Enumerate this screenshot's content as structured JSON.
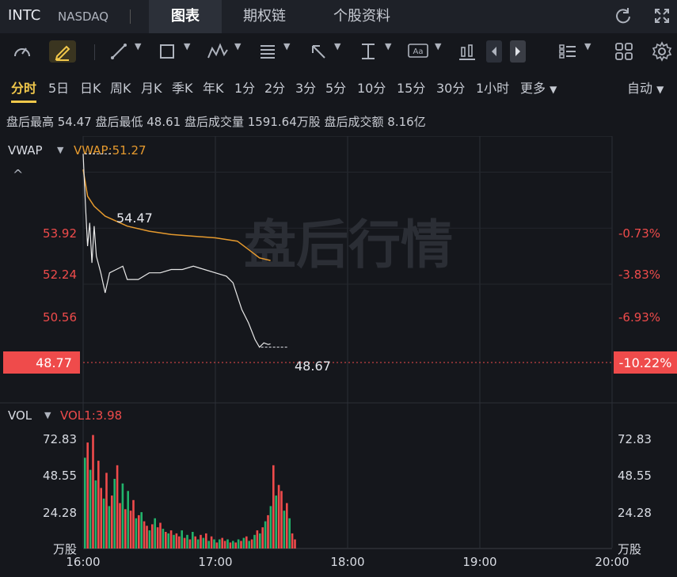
{
  "header": {
    "symbol": "INTC",
    "exchange": "NASDAQ",
    "tabs": [
      {
        "label": "图表",
        "active": true
      },
      {
        "label": "期权链",
        "active": false
      },
      {
        "label": "个股资料",
        "active": false
      }
    ]
  },
  "toolbar": {
    "tools": [
      "gauge-icon",
      "pen-icon",
      "line-icon",
      "rect-icon",
      "wave-icon",
      "fib-icon",
      "arrow-icon",
      "measure-icon",
      "text-icon",
      "candle-icon",
      "prev-icon",
      "next-icon",
      "list-icon",
      "grid-icon",
      "gear-icon"
    ],
    "text_tool_label": "Aa"
  },
  "periods": {
    "items": [
      "分时",
      "5日",
      "日K",
      "周K",
      "月K",
      "季K",
      "年K",
      "1分",
      "2分",
      "3分",
      "5分",
      "10分",
      "15分",
      "30分",
      "1小时",
      "更多"
    ],
    "active_index": 0,
    "auto_label": "自动"
  },
  "stats": {
    "text": "盘后最高 54.47  盘后最低 48.61  盘后成交量 1591.64万股  盘后成交额 8.16亿"
  },
  "price_pane": {
    "indicator": "VWAP",
    "indicator_value": "VWAP:51.27",
    "watermark": "盘后行情",
    "y_labels_left": [
      "53.92",
      "52.24",
      "50.56"
    ],
    "y_labels_right": [
      "-0.73%",
      "-3.83%",
      "-6.93%"
    ],
    "current_price": "48.77",
    "current_pct": "-10.22%",
    "high_label": "54.47",
    "low_label": "48.67"
  },
  "volume_pane": {
    "indicator": "VOL",
    "indicator_value": "VOL1:3.98",
    "y_labels": [
      "72.83",
      "48.55",
      "24.28"
    ],
    "unit": "万股"
  },
  "time_axis": [
    "16:00",
    "17:00",
    "18:00",
    "19:00",
    "20:00"
  ],
  "colors": {
    "up": "#21b36b",
    "down": "#ef4b4b",
    "vwap": "#e69a2e",
    "price": "#e8e8e8",
    "accent": "#f1c84b"
  },
  "chart_data": {
    "type": "line",
    "x_range": [
      "16:00",
      "20:00"
    ],
    "ylim": [
      47.0,
      55.0
    ],
    "series": [
      {
        "name": "VWAP",
        "x": [
          "16:00",
          "16:02",
          "16:05",
          "16:10",
          "16:20",
          "16:30",
          "16:40",
          "17:00",
          "17:10",
          "17:15",
          "17:20",
          "17:25"
        ],
        "values": [
          54.0,
          53.2,
          52.9,
          52.6,
          52.3,
          52.15,
          52.05,
          51.95,
          51.85,
          51.6,
          51.35,
          51.27
        ]
      },
      {
        "name": "",
        "x": [
          "16:00",
          "16:01",
          "16:02",
          "16:03",
          "16:04",
          "16:05",
          "16:06",
          "16:08",
          "16:10",
          "16:12",
          "16:15",
          "16:18",
          "16:20",
          "16:25",
          "16:30",
          "16:35",
          "16:40",
          "16:45",
          "16:50",
          "16:55",
          "17:00",
          "17:05",
          "17:08",
          "17:10",
          "17:12",
          "17:15",
          "17:18",
          "17:20",
          "17:22",
          "17:24",
          "17:25"
        ],
        "values": [
          54.47,
          53.0,
          51.7,
          52.4,
          51.2,
          52.3,
          51.4,
          50.9,
          50.3,
          50.9,
          51.0,
          51.1,
          50.7,
          50.7,
          50.9,
          50.9,
          51.0,
          51.0,
          51.1,
          51.0,
          50.9,
          50.8,
          50.6,
          50.2,
          49.8,
          49.4,
          48.9,
          48.67,
          48.8,
          48.75,
          48.77
        ]
      }
    ],
    "volume": {
      "ylim": [
        0,
        80
      ],
      "values": [
        60,
        70,
        52,
        75,
        45,
        58,
        40,
        33,
        50,
        28,
        35,
        46,
        55,
        30,
        43,
        26,
        38,
        25,
        32,
        20,
        22,
        24,
        18,
        15,
        12,
        16,
        20,
        14,
        17,
        13,
        11,
        10,
        12,
        9,
        10,
        8,
        12,
        7,
        9,
        6,
        11,
        8,
        6,
        9,
        7,
        10,
        5,
        8,
        6,
        4,
        6,
        7,
        5,
        6,
        4,
        5,
        4,
        6,
        5,
        7,
        8,
        5,
        6,
        9,
        12,
        10,
        14,
        18,
        22,
        28,
        55,
        35,
        42,
        38,
        25,
        30,
        20,
        10,
        6
      ],
      "colors": [
        "up",
        "down",
        "up",
        "down",
        "up",
        "down",
        "down",
        "up",
        "down",
        "up",
        "down",
        "up",
        "down",
        "down",
        "up",
        "down",
        "up",
        "down",
        "down",
        "up",
        "down",
        "up",
        "down",
        "down",
        "up",
        "down",
        "up",
        "down",
        "down",
        "up",
        "down",
        "up",
        "down",
        "up",
        "down",
        "down",
        "up",
        "down",
        "up",
        "down",
        "up",
        "down",
        "up",
        "down",
        "up",
        "down",
        "up",
        "down",
        "up",
        "down",
        "up",
        "down",
        "down",
        "up",
        "down",
        "up",
        "down",
        "up",
        "down",
        "up",
        "down",
        "up",
        "down",
        "up",
        "down",
        "up",
        "down",
        "up",
        "down",
        "up",
        "down",
        "up",
        "down",
        "down",
        "up",
        "down",
        "up",
        "down",
        "down"
      ]
    }
  }
}
